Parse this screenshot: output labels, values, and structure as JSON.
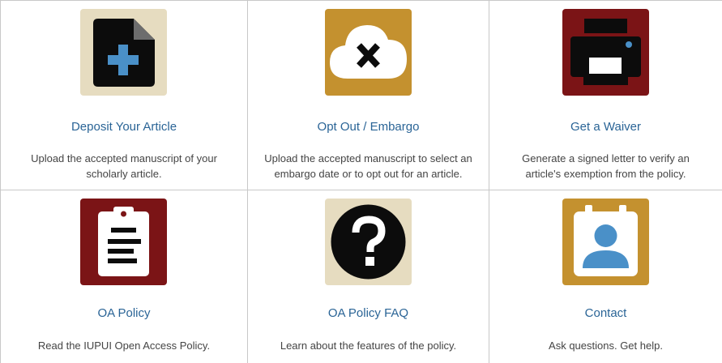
{
  "tiles": [
    {
      "title": "Deposit Your Article",
      "description": "Upload the accepted manuscript of your scholarly article.",
      "icon": "file-add-icon",
      "color": "#e6dcc0"
    },
    {
      "title": "Opt Out / Embargo",
      "description": "Upload the accepted manuscript to select an embargo date or to opt out for an article.",
      "icon": "cloud-x-icon",
      "color": "#c4912f"
    },
    {
      "title": "Get a Waiver",
      "description": "Generate a signed letter to verify an article's exemption from the policy.",
      "icon": "printer-icon",
      "color": "#7b1416"
    },
    {
      "title": "OA Policy",
      "description": "Read the IUPUI Open Access Policy.",
      "icon": "clipboard-icon",
      "color": "#7b1416"
    },
    {
      "title": "OA Policy FAQ",
      "description": "Learn about the features of the policy.",
      "icon": "question-icon",
      "color": "#e6dcc0"
    },
    {
      "title": "Contact",
      "description": "Ask questions. Get help.",
      "icon": "contact-card-icon",
      "color": "#c4912f"
    }
  ],
  "colors": {
    "link": "#2a6496",
    "text": "#444444",
    "border": "#c8c8c8",
    "accent_blue": "#4a90c8"
  }
}
